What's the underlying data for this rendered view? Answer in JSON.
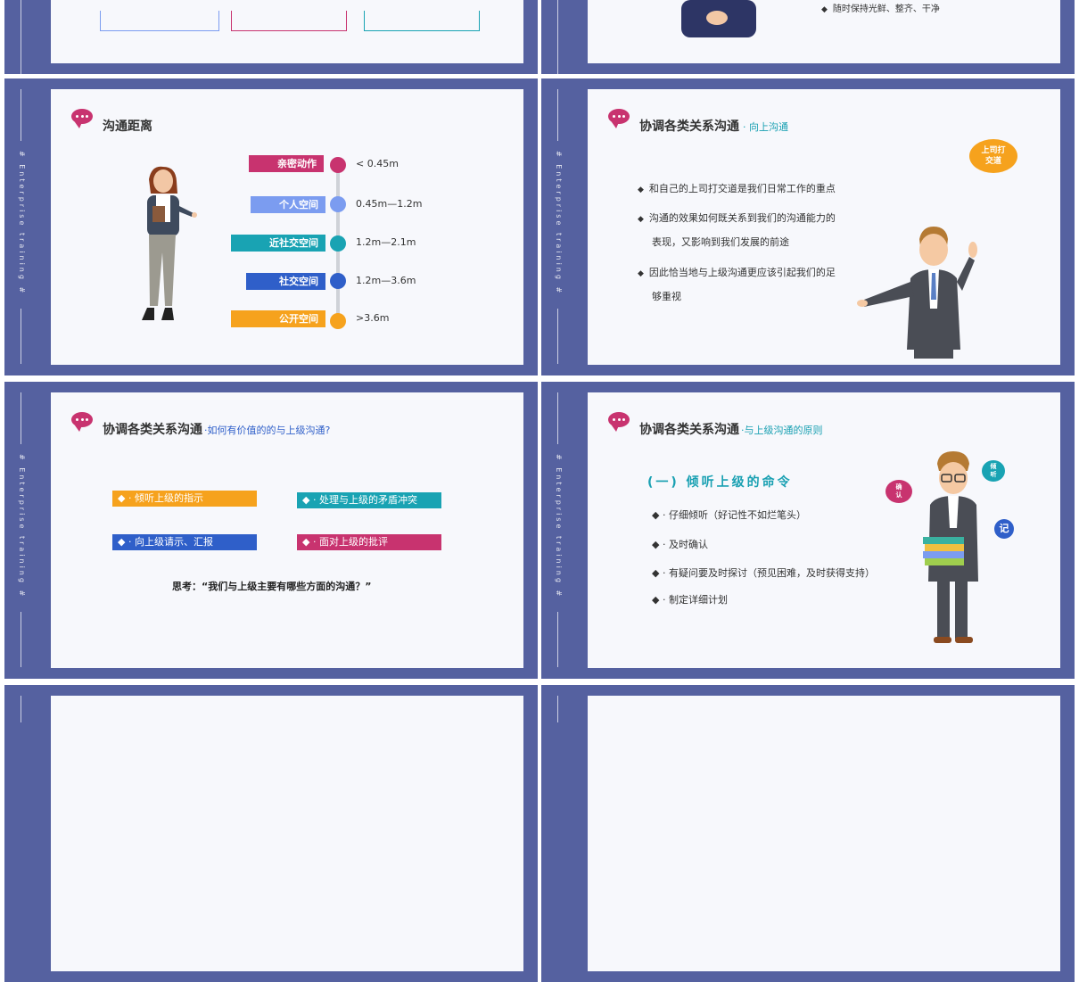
{
  "side_text": "# Enterprise training #",
  "top_right": {
    "bullet": "随时保持光鲜、整齐、干净"
  },
  "slide1": {
    "title": "沟通距离",
    "zones": [
      {
        "label": "亲密动作",
        "range": "< 0.45m",
        "color": "#c8336f"
      },
      {
        "label": "个人空间",
        "range": "0.45m—1.2m",
        "color": "#7b9cf0"
      },
      {
        "label": "近社交空间",
        "range": "1.2m—2.1m",
        "color": "#19a3b3"
      },
      {
        "label": "社交空间",
        "range": "1.2m—3.6m",
        "color": "#2f5fc9"
      },
      {
        "label": "公开空间",
        "range": ">3.6m",
        "color": "#f6a21d"
      }
    ]
  },
  "slide2": {
    "title": "协调各类关系沟通",
    "subtitle": "· 向上沟通",
    "bubble": "上司打交道",
    "bullets": [
      "和自己的上司打交道是我们日常工作的重点",
      "沟通的效果如何既关系到我们的沟通能力的",
      "表现，又影响到我们发展的前途",
      "因此恰当地与上级沟通更应该引起我们的足",
      "够重视"
    ]
  },
  "slide3": {
    "title": "协调各类关系沟通",
    "subtitle": "·如何有价值的的与上级沟通?",
    "boxes": [
      {
        "label": "◆ · 倾听上级的指示",
        "color": "#f6a21d"
      },
      {
        "label": "◆ · 处理与上级的矛盾冲突",
        "color": "#19a3b3"
      },
      {
        "label": "◆ · 向上级请示、汇报",
        "color": "#2f5fc9"
      },
      {
        "label": "◆ · 面对上级的批评",
        "color": "#c8336f"
      }
    ],
    "question": "思考：“我们与上级主要有哪些方面的沟通？”"
  },
  "slide4": {
    "title": "协调各类关系沟通",
    "subtitle": "·与上级沟通的原则",
    "heading": "(一) 倾听上级的命令",
    "bullets": [
      "◆ · 仔细倾听（好记性不如烂笔头）",
      "◆ · 及时确认",
      "◆ · 有疑问要及时探讨（预见困难，及时获得支持）",
      "◆ · 制定详细计划"
    ],
    "bubbles": [
      "倾听",
      "确认",
      "记"
    ]
  },
  "colors": {
    "frame": "#5561a0",
    "card": "#f7f8fc",
    "accent": "#c8336f",
    "teal": "#19a0b2"
  }
}
